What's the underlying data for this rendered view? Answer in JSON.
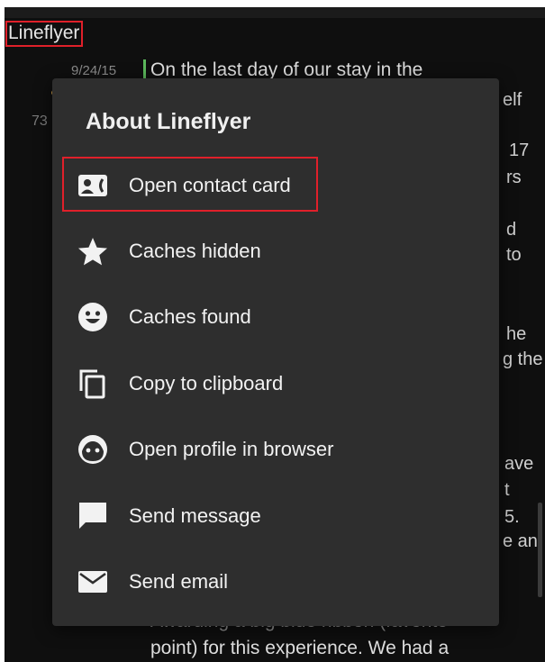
{
  "background": {
    "owner_name": "Lineflyer",
    "log_date": "9/24/15",
    "number_prefix": "73",
    "log_text_lines": [
      "On the last day of our stay in the",
      "Awarding a big blue ribbon (favorite",
      "point) for this experience. We had a"
    ],
    "peek_fragments": [
      "elf",
      "17",
      "rs",
      "d",
      "to",
      "he",
      "g the",
      "ave",
      "t",
      "5.",
      "e an"
    ]
  },
  "dialog": {
    "title": "About Lineflyer",
    "items": [
      {
        "label": "Open contact card",
        "icon": "contact-card-icon"
      },
      {
        "label": "Caches hidden",
        "icon": "star-icon"
      },
      {
        "label": "Caches found",
        "icon": "smiley-icon"
      },
      {
        "label": "Copy to clipboard",
        "icon": "copy-icon"
      },
      {
        "label": "Open profile in browser",
        "icon": "profile-face-icon"
      },
      {
        "label": "Send message",
        "icon": "message-bubble-icon"
      },
      {
        "label": "Send email",
        "icon": "envelope-icon"
      }
    ]
  },
  "colors": {
    "dialog_bg": "#2e2e2e",
    "highlight_outline": "#e0202a",
    "date_bar": "#5cb85c"
  }
}
